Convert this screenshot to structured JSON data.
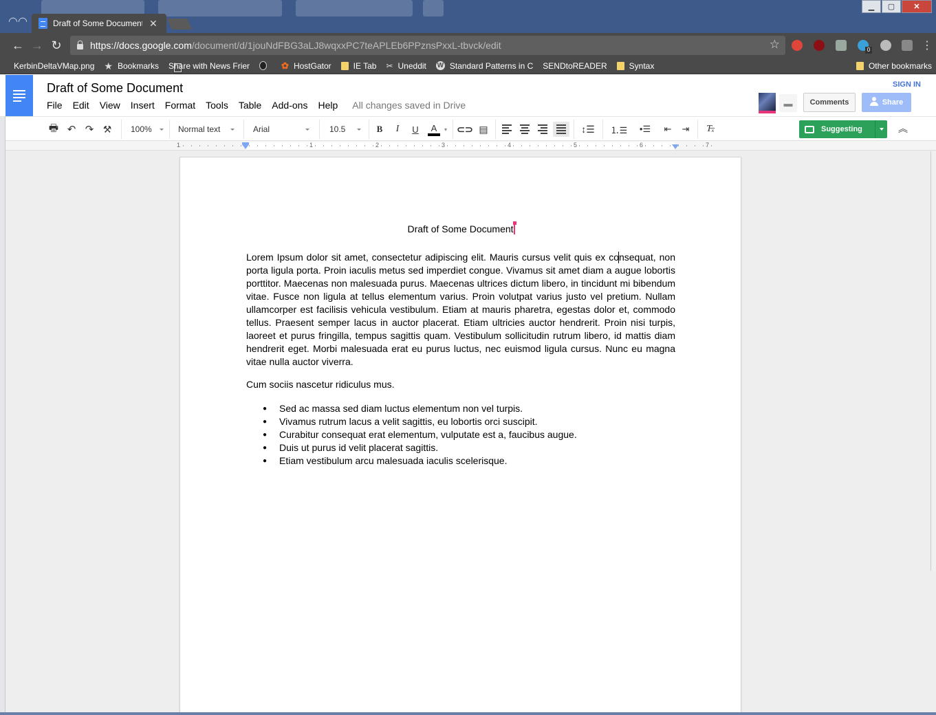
{
  "browser": {
    "tab_title": "Draft of Some Document",
    "url_host": "https://docs.google.com",
    "url_path": "/document/d/1jouNdFBG3aLJ8wqxxPC7teAPLEb6PPznsPxxL-tbvck/edit",
    "bookmarks": [
      {
        "label": "KerbinDeltaVMap.png",
        "icon": "page"
      },
      {
        "label": "Bookmarks",
        "icon": "star"
      },
      {
        "label": "Share with News Frier",
        "icon": "page"
      },
      {
        "label": "",
        "icon": "round"
      },
      {
        "label": "HostGator",
        "icon": "hg"
      },
      {
        "label": "IE Tab",
        "icon": "folder"
      },
      {
        "label": "Uneddit",
        "icon": "scissors"
      },
      {
        "label": "Standard Patterns in C",
        "icon": "wp"
      },
      {
        "label": "SENDtoREADER",
        "icon": "page"
      },
      {
        "label": "Syntax",
        "icon": "folder"
      }
    ],
    "other_bookmarks": "Other bookmarks",
    "extension_badge": "0"
  },
  "docs": {
    "title": "Draft of Some Document",
    "menu": [
      "File",
      "Edit",
      "View",
      "Insert",
      "Format",
      "Tools",
      "Table",
      "Add-ons",
      "Help"
    ],
    "save_status": "All changes saved in Drive",
    "sign_in": "SIGN IN",
    "comments_label": "Comments",
    "share_label": "Share"
  },
  "toolbar": {
    "zoom": "100%",
    "style": "Normal text",
    "font": "Arial",
    "font_size": "10.5",
    "bold": "B",
    "italic": "I",
    "underline": "U",
    "text_color": "A",
    "mode": "Suggesting"
  },
  "ruler": {
    "labels": [
      "1",
      "1",
      "2",
      "3",
      "4",
      "5",
      "6",
      "7"
    ]
  },
  "document": {
    "heading": "Draft of Some Document",
    "paragraph1": "Lorem Ipsum dolor sit amet, consectetur adipiscing elit. Mauris cursus velit quis ex consequat, non porta ligula porta. Proin iaculis metus sed imperdiet congue. Vivamus sit amet diam a augue lobortis porttitor. Maecenas non malesuada purus. Maecenas ultrices dictum libero, in tincidunt mi bibendum vitae. Fusce non ligula at tellus elementum varius. Proin volutpat varius justo vel pretium. Nullam ullamcorper est facilisis vehicula vestibulum. Etiam at mauris pharetra, egestas dolor et, commodo tellus. Praesent semper lacus in auctor placerat. Etiam ultricies auctor hendrerit. Proin nisi turpis, laoreet et purus fringilla, tempus sagittis quam. Vestibulum sollicitudin rutrum libero, id mattis diam hendrerit eget. Morbi malesuada erat eu purus luctus, nec euismod ligula cursus. Nunc eu magna vitae nulla auctor viverra.",
    "paragraph2": "Cum sociis nascetur ridiculus mus.",
    "bullets": [
      "Sed ac massa sed diam luctus elementum non vel turpis.",
      "Vivamus rutrum lacus a velit sagittis, eu lobortis orci suscipit.",
      "Curabitur consequat erat elementum, vulputate est a, faucibus augue.",
      "Duis ut purus id velit placerat sagittis.",
      "Etiam vestibulum arcu malesuada iaculis scelerisque."
    ]
  },
  "colors": {
    "docs_blue": "#4285f4",
    "suggesting_green": "#2ba15a",
    "cursor_pink": "#e8357a",
    "share_blue": "#9dbcf8"
  }
}
